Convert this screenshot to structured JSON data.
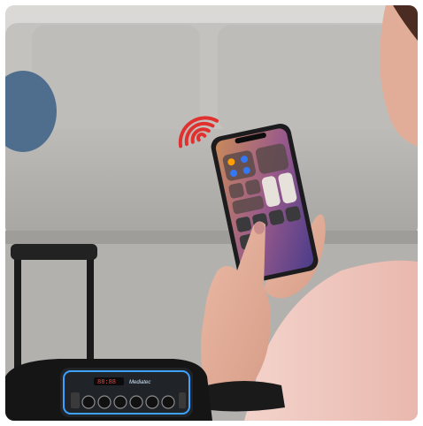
{
  "scene": {
    "subject": "hand-holding-phone-near-bluetooth-speaker",
    "icons": [
      "wifi-signal-icon",
      "phone-control-center",
      "party-speaker"
    ],
    "colors": {
      "wall": "#d7d5d2",
      "sofa": "#b8b6b2",
      "floor": "#a9a7a4",
      "skin": "#e3b29e",
      "sleeve": "#f0c9c1",
      "signal": "#e0312f",
      "speaker_led": "#3da2ff"
    }
  },
  "speaker": {
    "display_text": "88:88",
    "brand_text": "Mediatec"
  }
}
